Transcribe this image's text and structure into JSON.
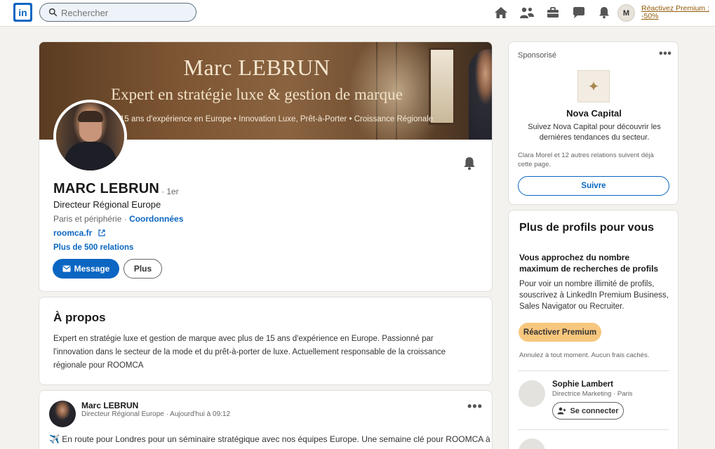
{
  "header": {
    "logo_text": "in",
    "search_placeholder": "Rechercher",
    "avatar_initial": "M",
    "premium_link": "Réactivez Premium : -50%"
  },
  "profile": {
    "banner_title": "Marc LEBRUN",
    "banner_subtitle": "Expert en stratégie luxe & gestion de marque",
    "banner_line": "15 ans d'expérience en Europe • Innovation Luxe, Prêt-à-Porter • Croissance Régionale",
    "name": "MARC LEBRUN",
    "degree": "· 1er",
    "headline": "Directeur Régional Europe",
    "location": "Paris et périphérie ·",
    "contact_link": "Coordonnées",
    "website": "roomca.fr",
    "connections": "Plus de 500 relations",
    "message_button": "Message",
    "more_button": "Plus"
  },
  "about": {
    "title": "À propos",
    "text": "Expert en stratégie luxe et gestion de marque avec plus de 15 ans d'expérience en Europe. Passionné par l'innovation dans le secteur de la mode et du prêt-à-porter de luxe. Actuellement responsable de la croissance régionale pour ROOMCA"
  },
  "post": {
    "author": "Marc LEBRUN",
    "meta": "Directeur Régional Europe · Aujourd'hui à 09:12",
    "more": "•••",
    "text": "✈️ En route pour Londres pour un séminaire stratégique avec nos équipes Europe. Une semaine clé pour ROOMCA à"
  },
  "sponsored": {
    "label": "Sponsorisé",
    "more": "•••",
    "logo_glyph": "✦",
    "company": "Nova Capital",
    "description": "Suivez Nova Capital pour découvrir les dernières tendances du secteur.",
    "social_proof": "Clara Morel et 12 autres relations suivent déjà cette page.",
    "follow_button": "Suivre"
  },
  "profiles": {
    "title": "Plus de profils pour vous",
    "limit_title": "Vous approchez du nombre maximum de recherches de profils",
    "limit_desc": "Pour voir un nombre illimité de profils, souscrivez à LinkedIn Premium Business, Sales Navigator ou Recruiter.",
    "premium_button": "Réactiver Premium",
    "cancel_note": "Annulez à tout moment. Aucun frais cachés.",
    "suggestions": [
      {
        "name": "Sophie Lambert",
        "role": "Directrice Marketing · Paris",
        "connect_button": "Se connecter"
      }
    ]
  },
  "colors": {
    "brand": "#0a66c2",
    "premium": "#f8c77e",
    "premium_link": "#915907",
    "background": "#f4f2ee"
  },
  "icons": [
    "linkedin-logo-icon",
    "search-icon",
    "home-icon",
    "network-icon",
    "jobs-icon",
    "messaging-icon",
    "notifications-icon",
    "bell-icon",
    "external-link-icon",
    "envelope-icon",
    "add-person-icon"
  ]
}
